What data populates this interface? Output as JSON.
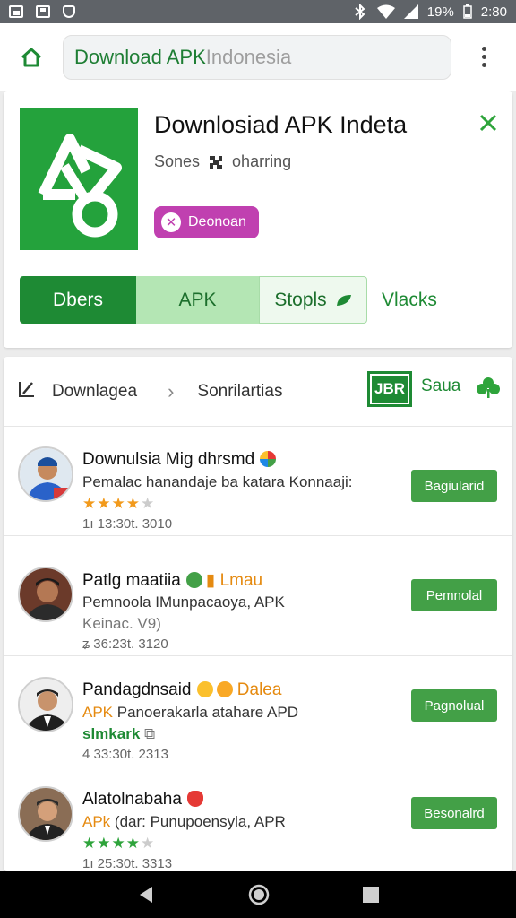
{
  "status_bar": {
    "battery": "19%",
    "time": "2:80"
  },
  "url_bar": {
    "url_main": "Download APK",
    "url_rest": " Indonesia"
  },
  "app": {
    "title": "Downlosiad APK Indeta",
    "meta_left": "Sones",
    "meta_right": "oharring",
    "pill_label": "Deonoan",
    "tabs": [
      "Dbers",
      "APK",
      "Stopls"
    ],
    "more_label": "Vlacks",
    "brand_color": "#24a23c"
  },
  "list": {
    "crumb_1": "Downlagea",
    "crumb_2": "Sonrilartias",
    "badge": "JBR",
    "save_label": "Saua",
    "items": [
      {
        "title": "Downulsia Mig dhrsmd",
        "desc": "Pemalac hanandaje ba katara Konnaaji:",
        "rating": 4,
        "time": "1ı 13:30t. 3010",
        "button": "Bagiularid"
      },
      {
        "title": "Patlg maatiia",
        "title_extra": "Lmau",
        "desc": "Pemnoola IMunpacaoya, APK",
        "sub": "Keinac. V9)",
        "time": "ʑ 36:23t. 3120",
        "button": "Pemnolal"
      },
      {
        "title": "Pandagdnsaid",
        "title_extra": "Dalea",
        "desc_prefix": "APK",
        "desc": " Panoerakarla atahare APD",
        "sub": "slmkark",
        "time": "4 33:30t. 2313",
        "button": "Pagnolual"
      },
      {
        "title": "Alatolnabaha",
        "desc_prefix": "APk",
        "desc": " (dar: Punupoensyla, APR",
        "rating": 4,
        "time": "1ı 25:30t. 3313",
        "button": "Besonalrd"
      }
    ]
  }
}
